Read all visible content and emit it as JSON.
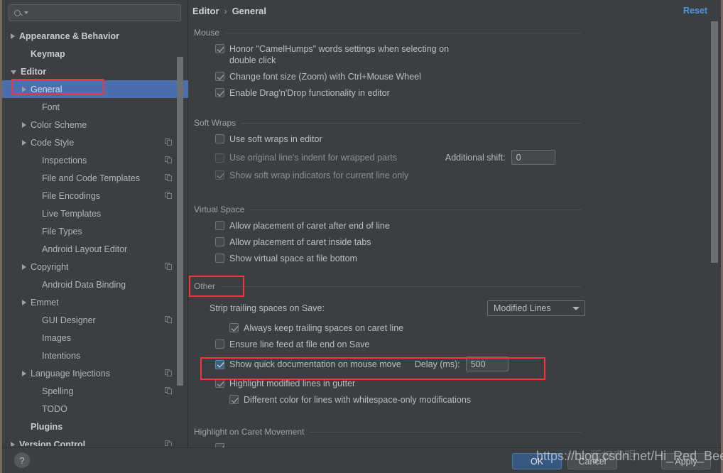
{
  "search": {
    "placeholder": "",
    "icon": "search-icon"
  },
  "sidebar": {
    "items": [
      {
        "label": "Appearance & Behavior",
        "arrow": "right",
        "bold": true,
        "indent": 0,
        "copy": false,
        "selected": false
      },
      {
        "label": "Keymap",
        "arrow": "none",
        "bold": true,
        "indent": 1,
        "copy": false,
        "selected": false
      },
      {
        "label": "Editor",
        "arrow": "down",
        "bold": true,
        "indent": 0,
        "copy": false,
        "selected": false
      },
      {
        "label": "General",
        "arrow": "right",
        "bold": false,
        "indent": 1,
        "copy": false,
        "selected": true
      },
      {
        "label": "Font",
        "arrow": "none",
        "bold": false,
        "indent": 2,
        "copy": false,
        "selected": false
      },
      {
        "label": "Color Scheme",
        "arrow": "right",
        "bold": false,
        "indent": 1,
        "copy": false,
        "selected": false
      },
      {
        "label": "Code Style",
        "arrow": "right",
        "bold": false,
        "indent": 1,
        "copy": true,
        "selected": false
      },
      {
        "label": "Inspections",
        "arrow": "none",
        "bold": false,
        "indent": 2,
        "copy": true,
        "selected": false
      },
      {
        "label": "File and Code Templates",
        "arrow": "none",
        "bold": false,
        "indent": 2,
        "copy": true,
        "selected": false
      },
      {
        "label": "File Encodings",
        "arrow": "none",
        "bold": false,
        "indent": 2,
        "copy": true,
        "selected": false
      },
      {
        "label": "Live Templates",
        "arrow": "none",
        "bold": false,
        "indent": 2,
        "copy": false,
        "selected": false
      },
      {
        "label": "File Types",
        "arrow": "none",
        "bold": false,
        "indent": 2,
        "copy": false,
        "selected": false
      },
      {
        "label": "Android Layout Editor",
        "arrow": "none",
        "bold": false,
        "indent": 2,
        "copy": false,
        "selected": false
      },
      {
        "label": "Copyright",
        "arrow": "right",
        "bold": false,
        "indent": 1,
        "copy": true,
        "selected": false
      },
      {
        "label": "Android Data Binding",
        "arrow": "none",
        "bold": false,
        "indent": 2,
        "copy": false,
        "selected": false
      },
      {
        "label": "Emmet",
        "arrow": "right",
        "bold": false,
        "indent": 1,
        "copy": false,
        "selected": false
      },
      {
        "label": "GUI Designer",
        "arrow": "none",
        "bold": false,
        "indent": 2,
        "copy": true,
        "selected": false
      },
      {
        "label": "Images",
        "arrow": "none",
        "bold": false,
        "indent": 2,
        "copy": false,
        "selected": false
      },
      {
        "label": "Intentions",
        "arrow": "none",
        "bold": false,
        "indent": 2,
        "copy": false,
        "selected": false
      },
      {
        "label": "Language Injections",
        "arrow": "right",
        "bold": false,
        "indent": 1,
        "copy": true,
        "selected": false
      },
      {
        "label": "Spelling",
        "arrow": "none",
        "bold": false,
        "indent": 2,
        "copy": true,
        "selected": false
      },
      {
        "label": "TODO",
        "arrow": "none",
        "bold": false,
        "indent": 2,
        "copy": false,
        "selected": false
      },
      {
        "label": "Plugins",
        "arrow": "none",
        "bold": true,
        "indent": 1,
        "copy": false,
        "selected": false
      },
      {
        "label": "Version Control",
        "arrow": "right",
        "bold": true,
        "indent": 0,
        "copy": true,
        "selected": false
      }
    ]
  },
  "breadcrumb": {
    "parent": "Editor",
    "separator": "›",
    "current": "General"
  },
  "header": {
    "reset_label": "Reset"
  },
  "groups": {
    "mouse": {
      "title": "Mouse",
      "items": [
        {
          "label": "Honor \"CamelHumps\" words settings when selecting on double click",
          "checked": true,
          "enabled": true
        },
        {
          "label": "Change font size (Zoom) with Ctrl+Mouse Wheel",
          "checked": true,
          "enabled": true
        },
        {
          "label": "Enable Drag'n'Drop functionality in editor",
          "checked": true,
          "enabled": true
        }
      ]
    },
    "soft_wraps": {
      "title": "Soft Wraps",
      "items": [
        {
          "label": "Use soft wraps in editor",
          "checked": false,
          "enabled": true
        },
        {
          "label": "Use original line's indent for wrapped parts",
          "checked": false,
          "enabled": false
        },
        {
          "label": "Show soft wrap indicators for current line only",
          "checked": true,
          "enabled": false
        }
      ],
      "additional_shift_label": "Additional shift:",
      "additional_shift_value": "0"
    },
    "virtual_space": {
      "title": "Virtual Space",
      "items": [
        {
          "label": "Allow placement of caret after end of line",
          "checked": false,
          "enabled": true
        },
        {
          "label": "Allow placement of caret inside tabs",
          "checked": false,
          "enabled": true
        },
        {
          "label": "Show virtual space at file bottom",
          "checked": false,
          "enabled": true
        }
      ]
    },
    "other": {
      "title": "Other",
      "strip_label": "Strip trailing spaces on Save:",
      "strip_value": "Modified Lines",
      "items": [
        {
          "label": "Always keep trailing spaces on caret line",
          "checked": true,
          "enabled": true,
          "indent": 2
        },
        {
          "label": "Ensure line feed at file end on Save",
          "checked": false,
          "enabled": true,
          "indent": 1
        },
        {
          "label": "Show quick documentation on mouse move",
          "checked": true,
          "enabled": true,
          "indent": 1,
          "highlight": true
        },
        {
          "label": "Highlight modified lines in gutter",
          "checked": true,
          "enabled": true,
          "indent": 1
        },
        {
          "label": "Different color for lines with whitespace-only modifications",
          "checked": true,
          "enabled": true,
          "indent": 2
        }
      ],
      "delay_label": "Delay (ms):",
      "delay_value": "500"
    },
    "highlight_caret": {
      "title": "Highlight on Caret Movement"
    }
  },
  "footer": {
    "help_label": "?",
    "ok_label": "OK",
    "cancel_label": "Cancel",
    "apply_label": "Apply"
  },
  "watermark": {
    "url": "https://blog.csdn.net/Hi_Red_Beetle",
    "cjk": "版权声明"
  },
  "colors": {
    "accent_selection": "#4b6eaf",
    "link": "#5294e2",
    "annotation_red": "#f5333f",
    "background": "#3c3f41",
    "primary_button": "#365880"
  }
}
